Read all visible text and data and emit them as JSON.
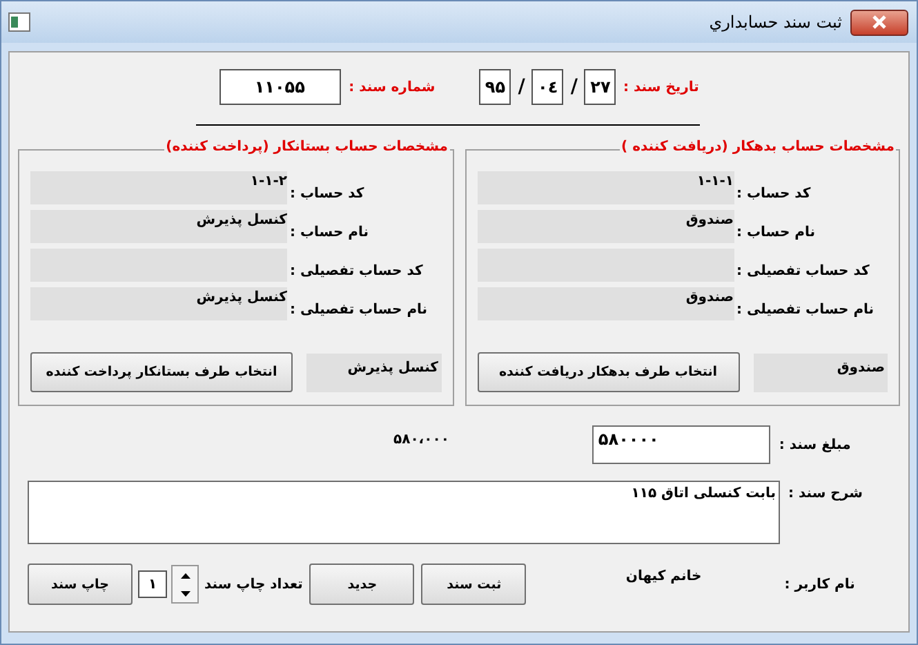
{
  "window": {
    "title": "ثبت سند حسابداري"
  },
  "header": {
    "date": {
      "label": "تاريخ سند :",
      "day": "۲۷",
      "month": "۰٤",
      "year": "۹۵",
      "separators": [
        "/",
        "/"
      ]
    },
    "doc_number": {
      "label": "شماره سند :",
      "value": "۱۱۰۵۵"
    }
  },
  "groups": [
    {
      "legend": "مشخصات حساب بدهکار (دریافت کننده )",
      "fields": [
        {
          "label": "کد حساب :",
          "value": "۱-۱-۱"
        },
        {
          "label": "نام حساب :",
          "value": "صندوق"
        },
        {
          "label": "کد حساب تفصیلی :"
        },
        {
          "label": "نام حساب تفصیلی :",
          "value": "صندوق"
        }
      ],
      "button": "انتخاب طرف بدهکار دریافت کننده",
      "summary": "صندوق"
    },
    {
      "legend": "مشخصات حساب بستانکار (پرداخت کننده)",
      "fields": [
        {
          "label": "کد حساب :",
          "value": "۱-۱-۲"
        },
        {
          "label": "نام حساب :",
          "value": "کنسل  پذیرش"
        },
        {
          "label": "کد حساب تفصیلی :"
        },
        {
          "label": "نام حساب تفصیلی :",
          "value": "کنسل  پذیرش"
        }
      ],
      "button": "انتخاب طرف بستانکار پرداخت کننده",
      "summary": "کنسل  پذیرش"
    }
  ],
  "amount": {
    "label": "مبلغ سند :",
    "value": "۵۸۰۰۰۰",
    "formatted": "۵۸۰،۰۰۰"
  },
  "description": {
    "label": "شرح سند :",
    "value": "بابت کنسلی اتاق ۱۱۵"
  },
  "footer": {
    "user_label": "نام کاربر :",
    "user": "خانم کیهان",
    "buttons": [
      "ثبت سند",
      "جدید"
    ],
    "print_count_label": "تعداد چاپ سند",
    "print_count": "۱",
    "print_button": "چاپ سند"
  }
}
